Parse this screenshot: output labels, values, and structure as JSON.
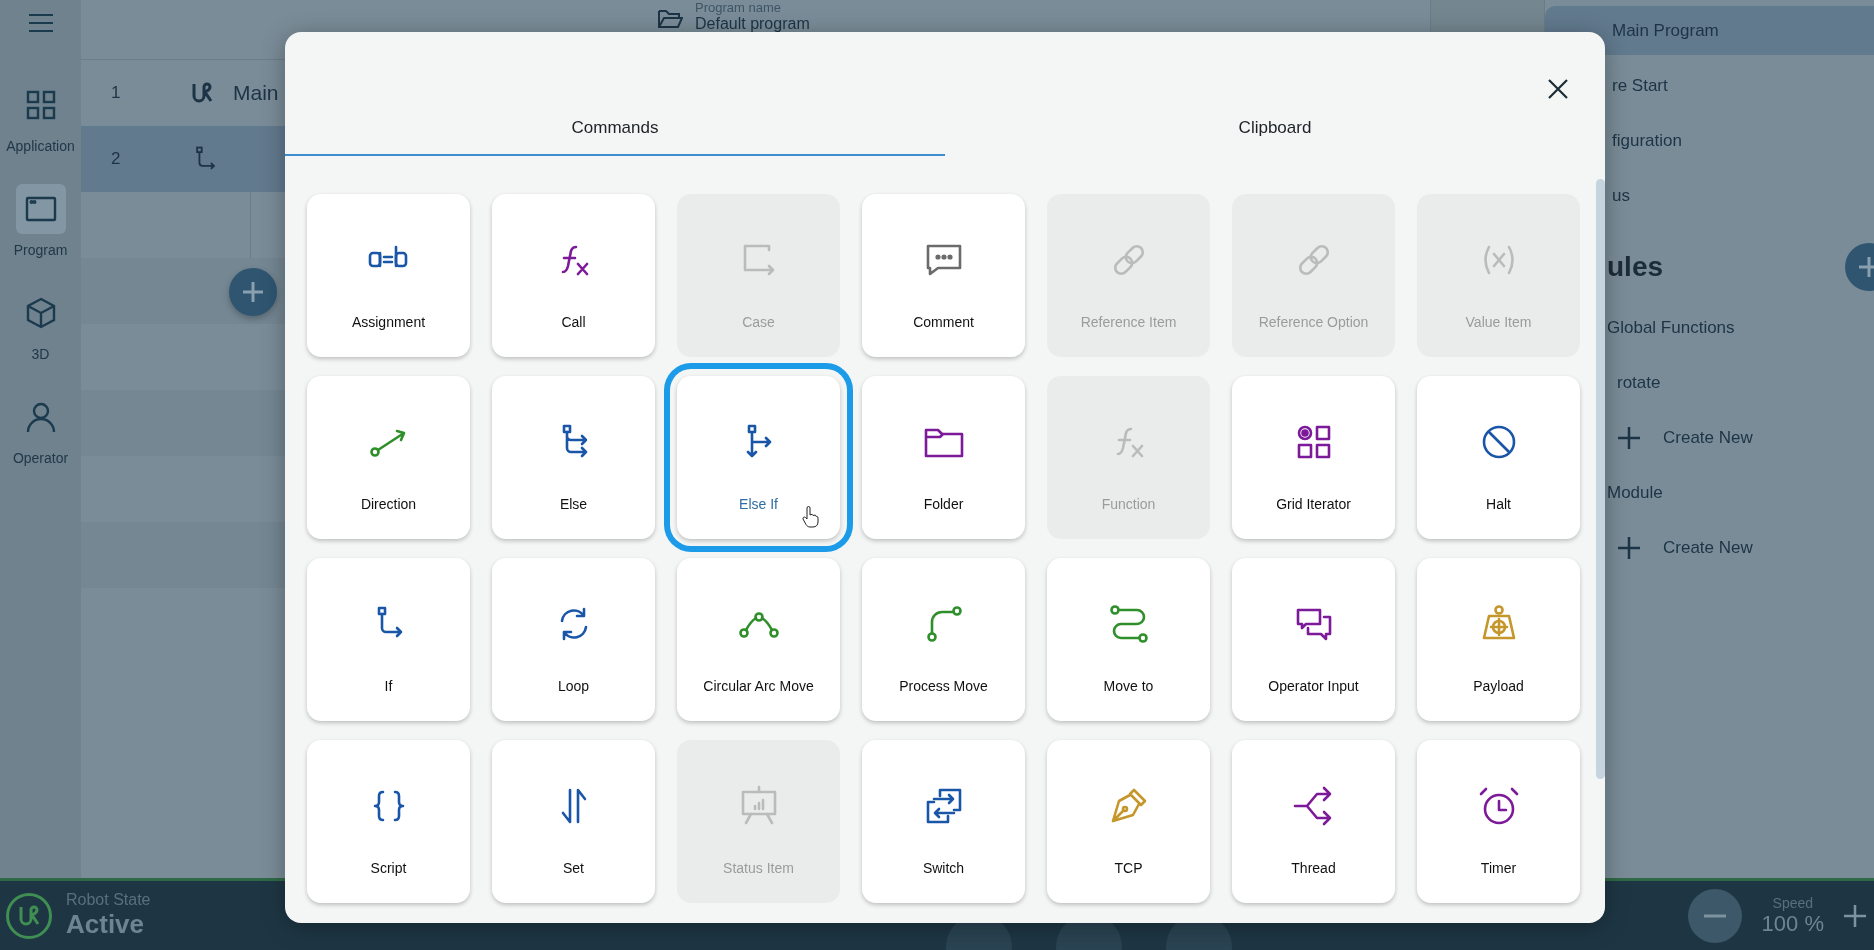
{
  "nav": {
    "items": [
      {
        "label": "Application",
        "selected": false
      },
      {
        "label": "Program",
        "selected": true
      },
      {
        "label": "3D",
        "selected": false
      },
      {
        "label": "Operator",
        "selected": false
      }
    ]
  },
  "header": {
    "label": "Program name",
    "value": "Default program"
  },
  "program_rows": [
    {
      "number": "1",
      "text": "Main",
      "selected": false
    },
    {
      "number": "2",
      "selected": true
    }
  ],
  "side_panel": {
    "items": [
      {
        "label": "Main Program",
        "selected": true
      },
      {
        "label": "re Start",
        "selected": false
      },
      {
        "label": "figuration",
        "selected": false
      },
      {
        "label": "us",
        "selected": false
      }
    ],
    "section_title": "ules",
    "tree": [
      {
        "label": "Global Functions",
        "children": [
          {
            "label": "rotate",
            "kind": "item"
          },
          {
            "label": "Create New",
            "kind": "create"
          }
        ]
      },
      {
        "label": "Module",
        "children": [
          {
            "label": "Create New",
            "kind": "create"
          }
        ]
      }
    ]
  },
  "dialog": {
    "tabs": [
      {
        "label": "Commands",
        "selected": true
      },
      {
        "label": "Clipboard",
        "selected": false
      }
    ],
    "commands": [
      {
        "label": "Assignment",
        "color": "#1a56a8",
        "disabled": false,
        "selected": false
      },
      {
        "label": "Call",
        "color": "#7d1a9a",
        "disabled": false,
        "selected": false
      },
      {
        "label": "Case",
        "disabled": true,
        "selected": false
      },
      {
        "label": "Comment",
        "color": "#6b6b6b",
        "disabled": false,
        "selected": false
      },
      {
        "label": "Reference Item",
        "disabled": true,
        "selected": false
      },
      {
        "label": "Reference Option",
        "disabled": true,
        "selected": false
      },
      {
        "label": "Value Item",
        "disabled": true,
        "selected": false
      },
      {
        "label": "Direction",
        "color": "#2f8f2a",
        "disabled": false,
        "selected": false
      },
      {
        "label": "Else",
        "color": "#1a56a8",
        "disabled": false,
        "selected": false
      },
      {
        "label": "Else If",
        "color": "#1a56a8",
        "disabled": false,
        "selected": true,
        "hovered": true
      },
      {
        "label": "Folder",
        "color": "#7d1a9a",
        "disabled": false,
        "selected": false
      },
      {
        "label": "Function",
        "disabled": true,
        "selected": false
      },
      {
        "label": "Grid Iterator",
        "color": "#7d1a9a",
        "disabled": false,
        "selected": false
      },
      {
        "label": "Halt",
        "color": "#1a56a8",
        "disabled": false,
        "selected": false
      },
      {
        "label": "If",
        "color": "#1a56a8",
        "disabled": false,
        "selected": false
      },
      {
        "label": "Loop",
        "color": "#1a56a8",
        "disabled": false,
        "selected": false
      },
      {
        "label": "Circular Arc Move",
        "color": "#2f8f2a",
        "disabled": false,
        "selected": false
      },
      {
        "label": "Process Move",
        "color": "#2f8f2a",
        "disabled": false,
        "selected": false
      },
      {
        "label": "Move to",
        "color": "#2f8f2a",
        "disabled": false,
        "selected": false
      },
      {
        "label": "Operator Input",
        "color": "#7d1a9a",
        "disabled": false,
        "selected": false
      },
      {
        "label": "Payload",
        "color": "#c5962a",
        "disabled": false,
        "selected": false
      },
      {
        "label": "Script",
        "color": "#1a56a8",
        "disabled": false,
        "selected": false
      },
      {
        "label": "Set",
        "color": "#1a56a8",
        "disabled": false,
        "selected": false
      },
      {
        "label": "Status Item",
        "disabled": true,
        "selected": false
      },
      {
        "label": "Switch",
        "color": "#1a56a8",
        "disabled": false,
        "selected": false
      },
      {
        "label": "TCP",
        "color": "#c5962a",
        "disabled": false,
        "selected": false
      },
      {
        "label": "Thread",
        "color": "#7d1a9a",
        "disabled": false,
        "selected": false
      },
      {
        "label": "Timer",
        "color": "#7d1a9a",
        "disabled": false,
        "selected": false
      }
    ]
  },
  "status_bar": {
    "state_label": "Robot State",
    "state": "Active",
    "speed_label": "Speed",
    "speed": "100 %"
  }
}
